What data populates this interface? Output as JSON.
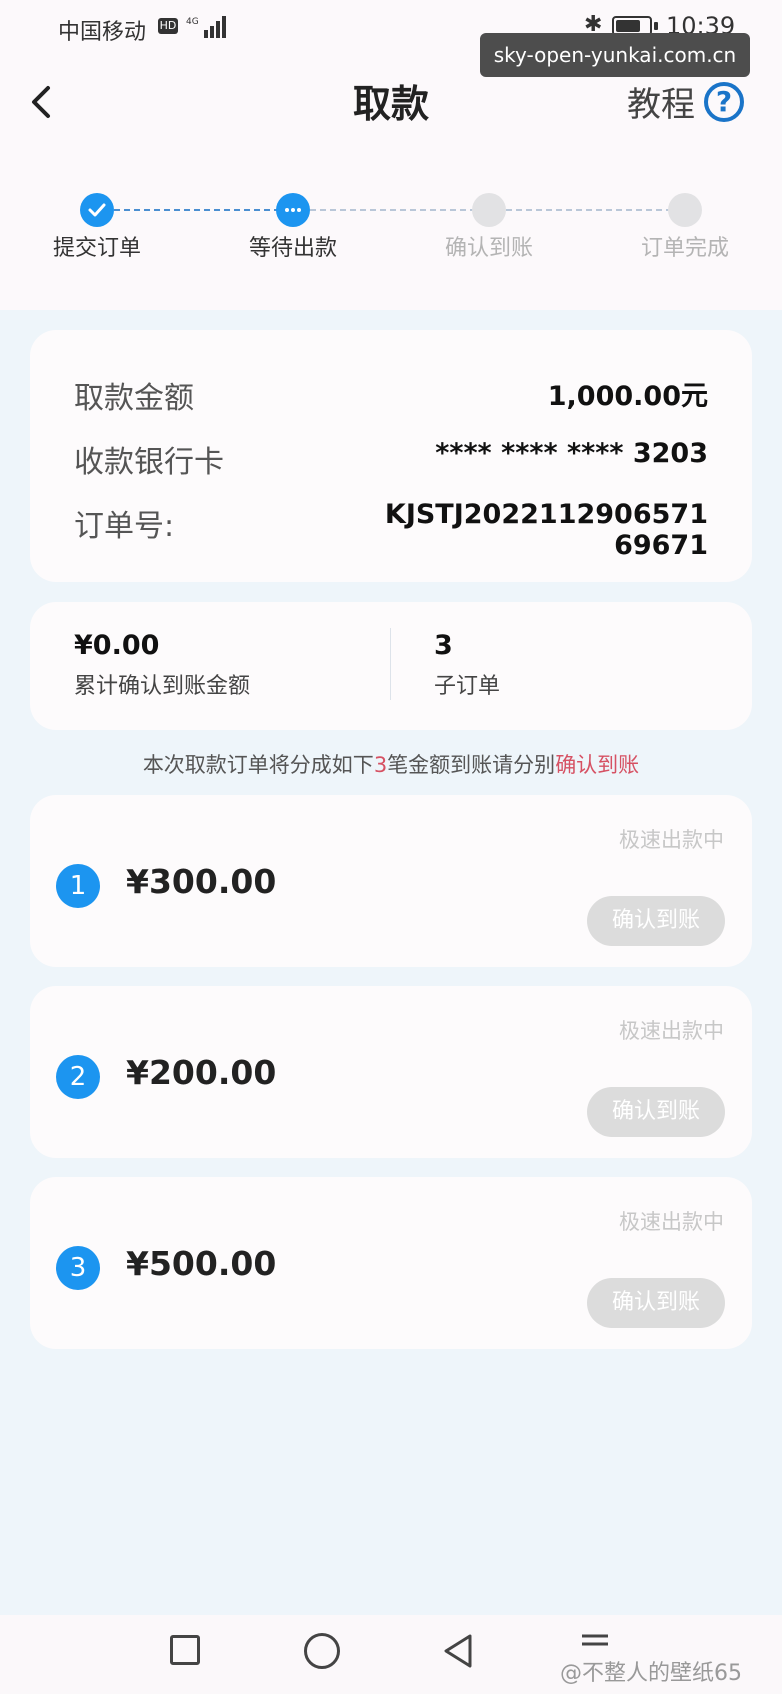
{
  "status_bar": {
    "carrier": "中国移动",
    "hd": "HD",
    "network": "4G",
    "time": "10:39"
  },
  "watermark_url": "sky-open-yunkai.com.cn",
  "header": {
    "title": "取款",
    "tutorial": "教程",
    "help_icon": "question-circle-icon"
  },
  "steps": [
    {
      "label": "提交订单",
      "state": "done"
    },
    {
      "label": "等待出款",
      "state": "current"
    },
    {
      "label": "确认到账",
      "state": "pending"
    },
    {
      "label": "订单完成",
      "state": "pending"
    }
  ],
  "info": {
    "amount_label": "取款金额",
    "amount_value": "1,000.00元",
    "card_label": "收款银行卡",
    "card_value": "**** **** **** 3203",
    "order_label": "订单号:",
    "order_value": "KJSTJ2022112906571 69671"
  },
  "stats": {
    "confirmed_amount": "¥0.00",
    "confirmed_label": "累计确认到账金额",
    "sub_orders": "3",
    "sub_orders_label": "子订单"
  },
  "notice": {
    "prefix": "本次取款订单将分成如下",
    "count": "3",
    "middle": "笔金额到账请分别",
    "action": "确认到账"
  },
  "sub_orders": [
    {
      "index": "1",
      "amount": "¥300.00",
      "status": "极速出款中",
      "button": "确认到账"
    },
    {
      "index": "2",
      "amount": "¥200.00",
      "status": "极速出款中",
      "button": "确认到账"
    },
    {
      "index": "3",
      "amount": "¥500.00",
      "status": "极速出款中",
      "button": "确认到账"
    }
  ],
  "footer_watermark": "@不整人的壁纸65",
  "colors": {
    "accent": "#1c95f0",
    "highlight": "#d65163",
    "disabled_button": "#dcdcdc"
  }
}
